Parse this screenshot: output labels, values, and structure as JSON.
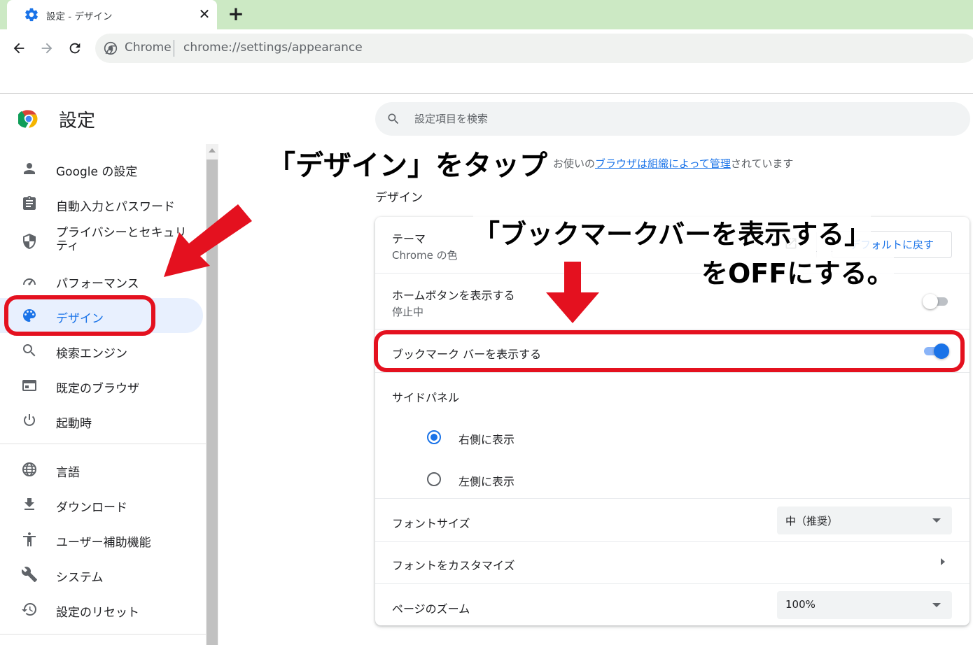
{
  "browser": {
    "tab_title": "設定 - デザイン",
    "tab_close": "✕",
    "new_tab": "+",
    "omnibox_label": "Chrome",
    "url": "chrome://settings/appearance"
  },
  "header": {
    "title": "設定",
    "search_placeholder": "設定項目を検索"
  },
  "sidebar": {
    "items": [
      {
        "label": "Google の設定",
        "icon": "person-icon"
      },
      {
        "label": "自動入力とパスワード",
        "icon": "clipboard-icon"
      },
      {
        "label": "プライバシーとセキュリティ",
        "icon": "shield-icon"
      },
      {
        "label": "パフォーマンス",
        "icon": "speedometer-icon"
      },
      {
        "label": "デザイン",
        "icon": "palette-icon",
        "selected": true
      },
      {
        "label": "検索エンジン",
        "icon": "search-icon"
      },
      {
        "label": "既定のブラウザ",
        "icon": "browser-icon"
      },
      {
        "label": "起動時",
        "icon": "power-icon"
      },
      {
        "label": "言語",
        "icon": "globe-icon"
      },
      {
        "label": "ダウンロード",
        "icon": "download-icon"
      },
      {
        "label": "ユーザー補助機能",
        "icon": "accessibility-icon"
      },
      {
        "label": "システム",
        "icon": "wrench-icon"
      },
      {
        "label": "設定のリセット",
        "icon": "history-icon"
      }
    ]
  },
  "main": {
    "managed_prefix": "お使いの",
    "managed_link": "ブラウザは組織によって管理",
    "managed_suffix": "されています",
    "section_title": "デザイン",
    "theme": {
      "title": "テーマ",
      "subtitle": "Chrome の色",
      "reset_label": "デフォルトに戻す"
    },
    "home_button": {
      "title": "ホームボタンを表示する",
      "subtitle": "停止中",
      "enabled": false
    },
    "bookmarks_bar": {
      "title": "ブックマーク バーを表示する",
      "enabled": true
    },
    "side_panel": {
      "title": "サイドパネル",
      "options": [
        "右側に表示",
        "左側に表示"
      ],
      "selected": "右側に表示"
    },
    "font_size": {
      "title": "フォントサイズ",
      "value": "中（推奨）"
    },
    "customize_fonts": {
      "title": "フォントをカスタマイズ"
    },
    "page_zoom": {
      "title": "ページのズーム",
      "value": "100%"
    }
  },
  "annotations": {
    "tap_design": "「デザイン」をタップ",
    "bookmark_line1": "「ブックマークバーを表示する」",
    "bookmark_line2": "をOFFにする。",
    "color": "#e4111f"
  },
  "colors": {
    "accent": "#1a73e8",
    "tabstrip": "#cce9c4",
    "highlight_bg": "#e8f0fe"
  }
}
